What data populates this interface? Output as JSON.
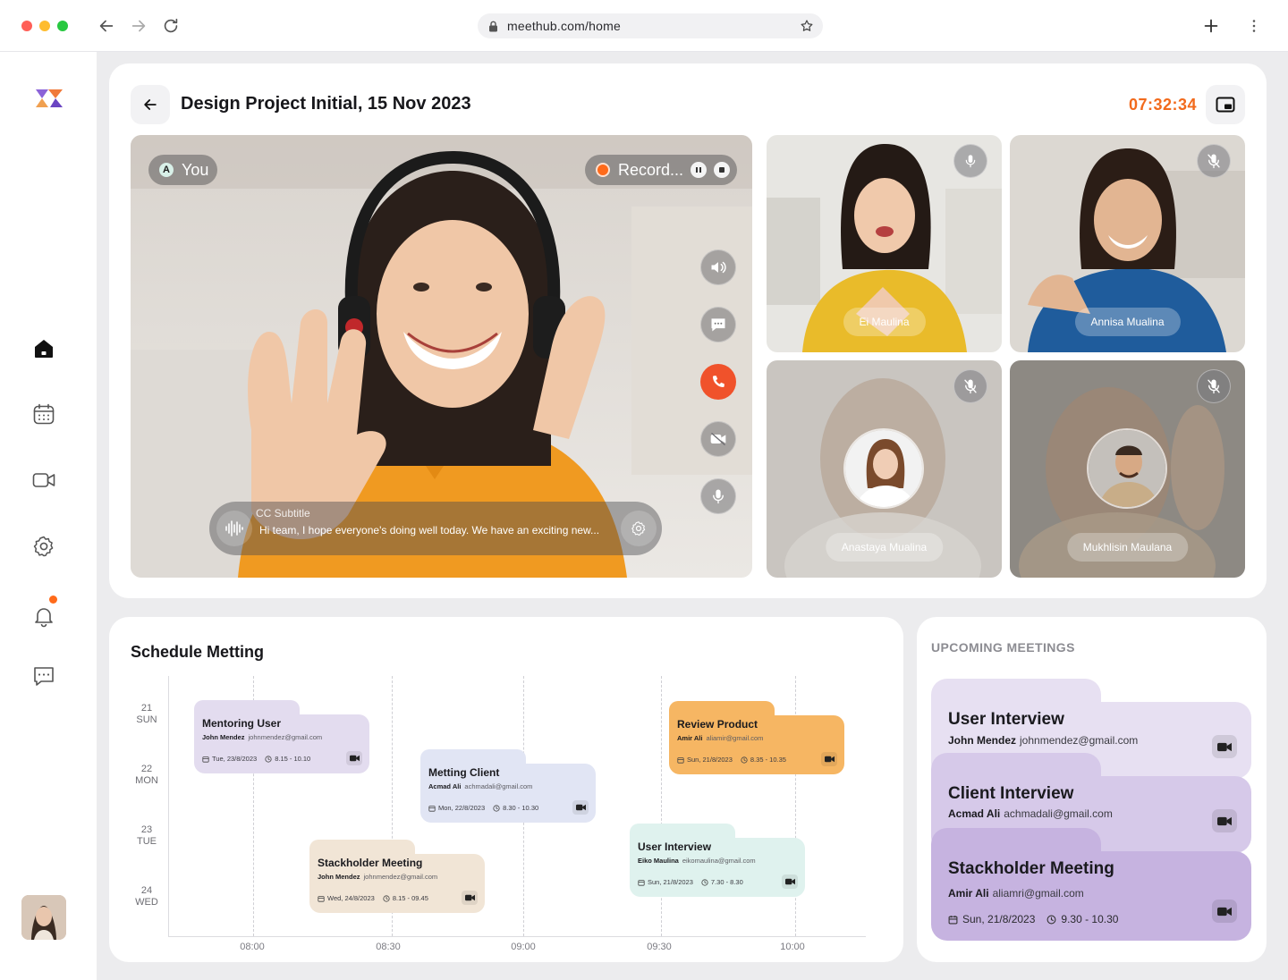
{
  "browser": {
    "url": "meethub.com/home"
  },
  "call": {
    "title": "Design Project Initial, 15 Nov 2023",
    "timer": "07:32:34",
    "self_initial": "A",
    "self_label": "You",
    "record_label": "Record...",
    "subtitle_heading": "CC Subtitle",
    "subtitle_text": "Hi team, I hope everyone's doing well today. We have an exciting new...",
    "participants": [
      {
        "name": "Ei Maulina",
        "muted": false
      },
      {
        "name": "Annisa Mualina",
        "muted": true
      },
      {
        "name": "Anastaya Mualina",
        "muted": true
      },
      {
        "name": "Mukhlisin Maulana",
        "muted": true
      }
    ]
  },
  "schedule": {
    "title": "Schedule Metting",
    "days": [
      {
        "num": "21",
        "dow": "SUN"
      },
      {
        "num": "22",
        "dow": "MON"
      },
      {
        "num": "23",
        "dow": "TUE"
      },
      {
        "num": "24",
        "dow": "WED"
      }
    ],
    "times": [
      "08:00",
      "08:30",
      "09:00",
      "09:30",
      "10:00"
    ],
    "events": [
      {
        "title": "Mentoring User",
        "person": "John Mendez",
        "email": "johnmendez@gmail.com",
        "date": "Tue, 23/8/2023",
        "time": "8.15 - 10.10",
        "color": "#e3dcef"
      },
      {
        "title": "Metting Client",
        "person": "Acmad Ali",
        "email": "achmadali@gmail.com",
        "date": "Mon, 22/8/2023",
        "time": "8.30 - 10.30",
        "color": "#e1e5f4"
      },
      {
        "title": "Review Product",
        "person": "Amir Ali",
        "email": "aliamir@gmail.com",
        "date": "Sun, 21/8/2023",
        "time": "8.35 - 10.35",
        "color": "#f6b663"
      },
      {
        "title": "User Interview",
        "person": "Eiko Maulina",
        "email": "eikomaulina@gmail.com",
        "date": "Sun, 21/8/2023",
        "time": "7.30 - 8.30",
        "color": "#dff2ee"
      },
      {
        "title": "Stackholder Meeting",
        "person": "John Mendez",
        "email": "johnmendez@gmail.com",
        "date": "Wed, 24/8/2023",
        "time": "8.15 - 09.45",
        "color": "#f1e5d6"
      }
    ]
  },
  "upcoming": {
    "heading": "UPCOMING MEETINGS",
    "items": [
      {
        "title": "User Interview",
        "person": "John Mendez",
        "email": "johnmendez@gmail.com",
        "color": "#e7e0f2"
      },
      {
        "title": "Client Interview",
        "person": "Acmad Ali",
        "email": "achmadali@gmail.com",
        "color": "#d6c9e9"
      },
      {
        "title": "Stackholder Meeting",
        "person": "Amir Ali",
        "email": "aliamri@gmail.com",
        "date": "Sun, 21/8/2023",
        "time": "9.30 - 10.30",
        "color": "#c6b3e0"
      }
    ]
  },
  "colors": {
    "accent": "#f26a1c",
    "end_call": "#f0522b",
    "notification": "#ff6a1a"
  },
  "icons": [
    "back-arrow-icon",
    "forward-arrow-icon",
    "reload-icon",
    "lock-icon",
    "star-icon",
    "plus-icon",
    "kebab-icon",
    "logo-icon",
    "home-icon",
    "calendar-icon",
    "video-icon",
    "settings-icon",
    "bell-icon",
    "chat-icon",
    "picture-in-picture-icon",
    "pause-icon",
    "stop-icon",
    "speaker-icon",
    "message-icon",
    "phone-icon",
    "camera-icon",
    "mic-icon",
    "mic-off-icon",
    "soundwave-icon",
    "gear-icon",
    "clock-icon"
  ]
}
